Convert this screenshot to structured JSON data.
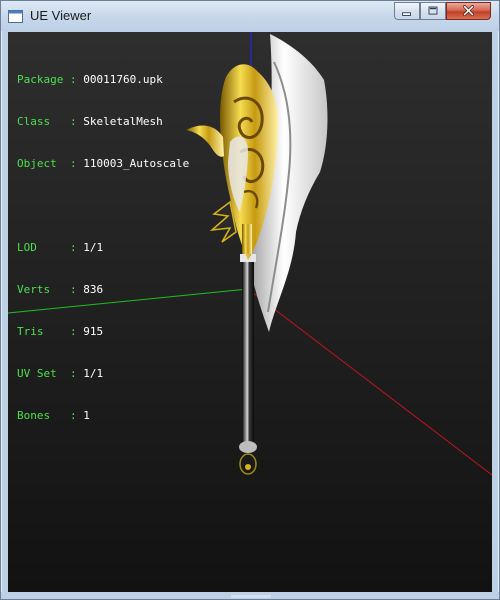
{
  "window": {
    "title": "UE Viewer",
    "icon": "app-window-icon",
    "controls": {
      "minimize": "minimize-icon",
      "maximize": "maximize-icon",
      "close": "close-icon"
    }
  },
  "info": {
    "package": {
      "label": "Package",
      "sep": ":",
      "value": "00011760.upk"
    },
    "class": {
      "label": "Class  ",
      "sep": ":",
      "value": "SkeletalMesh"
    },
    "object": {
      "label": "Object ",
      "sep": ":",
      "value": "110003_Autoscale"
    },
    "lod": {
      "label": "LOD    ",
      "sep": ":",
      "value": "1/1"
    },
    "verts": {
      "label": "Verts  ",
      "sep": ":",
      "value": "836"
    },
    "tris": {
      "label": "Tris   ",
      "sep": ":",
      "value": "915"
    },
    "uvset": {
      "label": "UV Set ",
      "sep": ":",
      "value": "1/1"
    },
    "bones": {
      "label": "Bones  ",
      "sep": ":",
      "value": "1"
    }
  },
  "colors": {
    "axis_x": "#c0161b",
    "axis_y": "#1fbf1f",
    "axis_z": "#2424ff",
    "label": "#4de04d",
    "gold": "#d8b21a"
  }
}
